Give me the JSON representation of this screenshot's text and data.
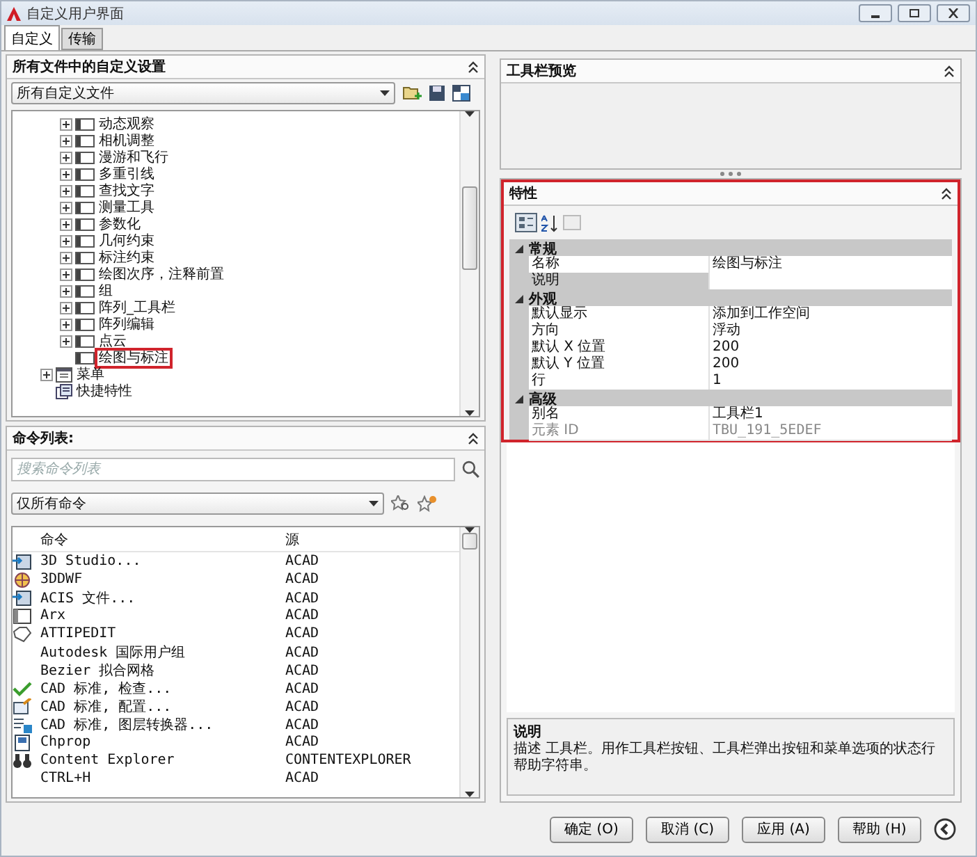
{
  "window": {
    "title": "自定义用户界面"
  },
  "tabs": [
    {
      "label": "自定义",
      "selected": true
    },
    {
      "label": "传输",
      "selected": false
    }
  ],
  "customizations": {
    "title": "所有文件中的自定义设置",
    "file_select": "所有自定义文件",
    "tree": [
      {
        "children": [
          {
            "label": "动态观察",
            "kind": "toolbar",
            "expandable": true,
            "highlighted": false
          },
          {
            "label": "相机调整",
            "kind": "toolbar",
            "expandable": true,
            "highlighted": false
          },
          {
            "label": "漫游和飞行",
            "kind": "toolbar",
            "expandable": true,
            "highlighted": false
          },
          {
            "label": "多重引线",
            "kind": "toolbar",
            "expandable": true,
            "highlighted": false
          },
          {
            "label": "查找文字",
            "kind": "toolbar",
            "expandable": true,
            "highlighted": false
          },
          {
            "label": "测量工具",
            "kind": "toolbar",
            "expandable": true,
            "highlighted": false
          },
          {
            "label": "参数化",
            "kind": "toolbar",
            "expandable": true,
            "highlighted": false
          },
          {
            "label": "几何约束",
            "kind": "toolbar",
            "expandable": true,
            "highlighted": false
          },
          {
            "label": "标注约束",
            "kind": "toolbar",
            "expandable": true,
            "highlighted": false
          },
          {
            "label": "绘图次序，注释前置",
            "kind": "toolbar",
            "expandable": true,
            "highlighted": false
          },
          {
            "label": "组",
            "kind": "toolbar",
            "expandable": true,
            "highlighted": false
          },
          {
            "label": "阵列_工具栏",
            "kind": "toolbar",
            "expandable": true,
            "highlighted": false
          },
          {
            "label": "阵列编辑",
            "kind": "toolbar",
            "expandable": true,
            "highlighted": false
          },
          {
            "label": "点云",
            "kind": "toolbar",
            "expandable": true,
            "highlighted": false
          },
          {
            "label": "绘图与标注",
            "kind": "toolbar",
            "expandable": false,
            "highlighted": true
          }
        ]
      },
      {
        "label": "菜单",
        "kind": "menu",
        "expandable": true,
        "highlighted": false
      },
      {
        "label": "快捷特性",
        "kind": "quick",
        "expandable": false,
        "highlighted": false
      }
    ]
  },
  "command_list": {
    "title": "命令列表:",
    "search": {
      "placeholder": "搜索命令列表"
    },
    "filter": "仅所有命令",
    "columns": [
      "命令",
      "源"
    ],
    "rows": [
      {
        "kind": "import",
        "command": "3D Studio...",
        "source": "ACAD"
      },
      {
        "kind": "globe",
        "command": "3DDWF",
        "source": "ACAD"
      },
      {
        "kind": "import",
        "command": "ACIS 文件...",
        "source": "ACAD"
      },
      {
        "kind": "window",
        "command": "Arx",
        "source": "ACAD"
      },
      {
        "kind": "tag",
        "command": "ATTIPEDIT",
        "source": "ACAD"
      },
      {
        "kind": "plain",
        "command": "Autodesk 国际用户组",
        "source": "ACAD"
      },
      {
        "kind": "plain",
        "command": "Bezier 拟合网格",
        "source": "ACAD"
      },
      {
        "kind": "check",
        "command": "CAD 标准, 检查...",
        "source": "ACAD"
      },
      {
        "kind": "config",
        "command": "CAD 标准, 配置...",
        "source": "ACAD"
      },
      {
        "kind": "layers",
        "command": "CAD 标准, 图层转换器...",
        "source": "ACAD"
      },
      {
        "kind": "sheet",
        "command": "Chprop",
        "source": "ACAD"
      },
      {
        "kind": "binoculars",
        "command": "Content Explorer",
        "source": "CONTENTEXPLORER"
      },
      {
        "kind": "plain",
        "command": "CTRL+H",
        "source": "ACAD"
      }
    ]
  },
  "toolbar_preview": {
    "title": "工具栏预览"
  },
  "properties": {
    "title": "特性",
    "highlighted": true,
    "sections": [
      {
        "title": "常规",
        "expanded": true,
        "rows": [
          {
            "name": "名称",
            "value": "绘图与标注",
            "selected": false,
            "disabled": false
          },
          {
            "name": "说明",
            "selected": true,
            "disabled": false
          }
        ]
      },
      {
        "title": "外观",
        "expanded": true,
        "rows": [
          {
            "name": "默认显示",
            "value": "添加到工作空间",
            "selected": false,
            "disabled": false
          },
          {
            "name": "方向",
            "value": "浮动",
            "selected": false,
            "disabled": false
          },
          {
            "name": "默认 X 位置",
            "value": "200",
            "selected": false,
            "disabled": false
          },
          {
            "name": "默认 Y 位置",
            "value": "200",
            "selected": false,
            "disabled": false
          },
          {
            "name": "行",
            "value": "1",
            "selected": false,
            "disabled": false
          }
        ]
      },
      {
        "title": "高级",
        "expanded": true,
        "rows": [
          {
            "name": "别名",
            "value": "工具栏1",
            "selected": false,
            "disabled": false
          },
          {
            "name": "元素 ID",
            "value": "TBU_191_5EDEF",
            "selected": false,
            "disabled": true
          }
        ]
      }
    ]
  },
  "description": {
    "title": "说明",
    "text": "描述 工具栏。用作工具栏按钮、工具栏弹出按钮和菜单选项的状态行帮助字符串。"
  },
  "buttons": [
    "确定 (O)",
    "取消 (C)",
    "应用 (A)",
    "帮助 (H)"
  ]
}
